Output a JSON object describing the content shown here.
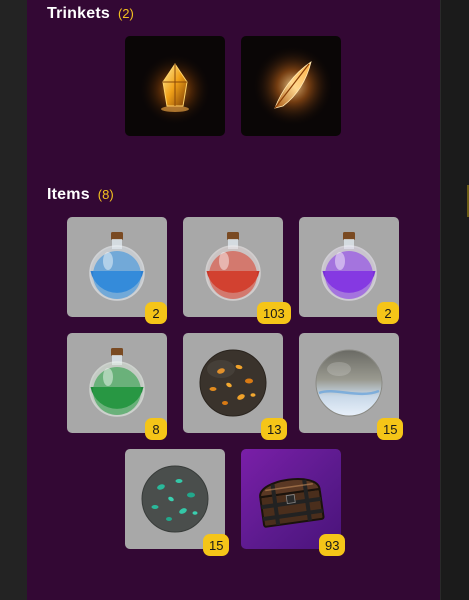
{
  "trinkets": {
    "title": "Trinkets",
    "count": "(2)",
    "items": [
      {
        "icon": "amber-crystal-icon"
      },
      {
        "icon": "golden-feather-icon"
      }
    ]
  },
  "items": {
    "title": "Items",
    "count": "(8)",
    "list": [
      {
        "icon": "blue-potion-icon",
        "quantity": "2"
      },
      {
        "icon": "red-potion-icon",
        "quantity": "103"
      },
      {
        "icon": "purple-potion-icon",
        "quantity": "2"
      },
      {
        "icon": "green-potion-icon",
        "quantity": "8"
      },
      {
        "icon": "amber-ore-sphere-icon",
        "quantity": "13"
      },
      {
        "icon": "silver-sphere-icon",
        "quantity": "15"
      },
      {
        "icon": "teal-ore-sphere-icon",
        "quantity": "15"
      },
      {
        "icon": "treasure-chest-icon",
        "quantity": "93"
      }
    ]
  },
  "colors": {
    "panel": "#330834",
    "accent": "#f4c21f",
    "tile": "#a8a8a8",
    "chest_tile": "#6a1d9a"
  }
}
